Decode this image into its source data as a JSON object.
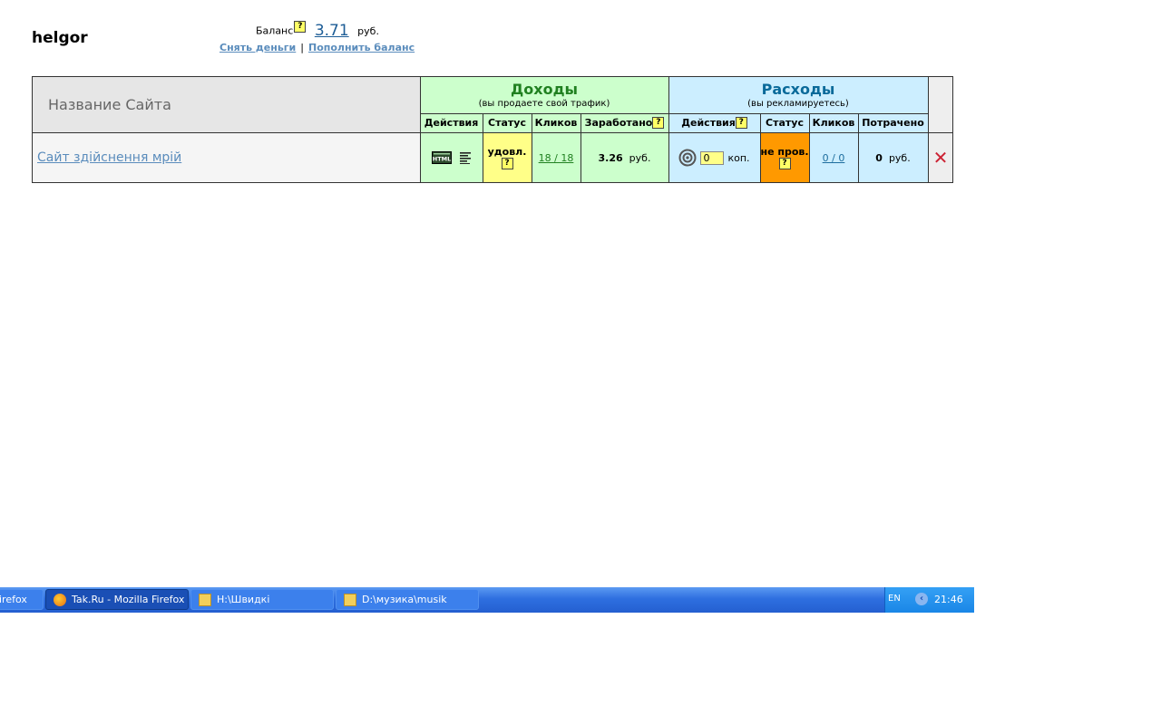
{
  "user": {
    "name": "helgor"
  },
  "balance": {
    "label": "Баланс",
    "help": "?",
    "amount": "3.71",
    "currency": "руб.",
    "withdraw": "Снять деньги",
    "separator": "|",
    "topup": "Пополнить баланс"
  },
  "table": {
    "name_header": "Название Сайта",
    "income": {
      "title": "Доходы",
      "subtitle": "(вы продаете свой трафик)",
      "columns": [
        "Действия",
        "Статус",
        "Кликов",
        "Заработано"
      ]
    },
    "expense": {
      "title": "Расходы",
      "subtitle": "(вы рекламируетесь)",
      "columns": [
        "Действия",
        "Статус",
        "Кликов",
        "Потрачено"
      ]
    },
    "help": "?",
    "row": {
      "site": "Сайт здійснення мрій",
      "income_status": "удовл.",
      "income_clicks": "18 / 18",
      "earned": "3.26",
      "earned_currency": "руб.",
      "cpc_value": "0",
      "cpc_unit": "коп.",
      "expense_status": "не пров.",
      "expense_clicks": "0 / 0",
      "spent": "0",
      "spent_currency": "руб."
    }
  },
  "taskbar": {
    "items": [
      "irefox",
      "Tak.Ru - Mozilla Firefox",
      "H:\\Швидкі",
      "D:\\музика\\musik"
    ],
    "lang": "EN",
    "time": "21:46"
  }
}
